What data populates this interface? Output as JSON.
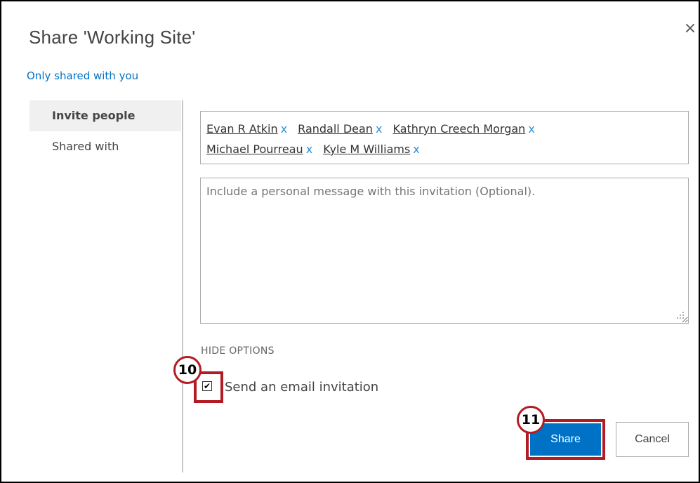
{
  "dialog": {
    "title": "Share 'Working Site'",
    "close_symbol": "×",
    "subtitle_link": "Only shared with you"
  },
  "nav": {
    "items": [
      {
        "label": "Invite people",
        "active": true
      },
      {
        "label": "Shared with",
        "active": false
      }
    ]
  },
  "people": [
    {
      "name": "Evan R Atkin",
      "remove": "x"
    },
    {
      "name": "Randall Dean",
      "remove": "x"
    },
    {
      "name": "Kathryn Creech Morgan",
      "remove": "x"
    },
    {
      "name": "Michael Pourreau",
      "remove": "x"
    },
    {
      "name": "Kyle M Williams",
      "remove": "x"
    }
  ],
  "message": {
    "placeholder": "Include a personal message with this invitation (Optional).",
    "value": ""
  },
  "options": {
    "toggle_label": "HIDE OPTIONS",
    "send_email_label": "Send an email invitation",
    "send_email_checked": true,
    "check_mark": "✔"
  },
  "buttons": {
    "share_label": "Share",
    "cancel_label": "Cancel"
  },
  "callouts": {
    "step_10": "10",
    "step_11": "11"
  },
  "colors": {
    "accent": "#0072c6",
    "callout": "#b31b24"
  }
}
